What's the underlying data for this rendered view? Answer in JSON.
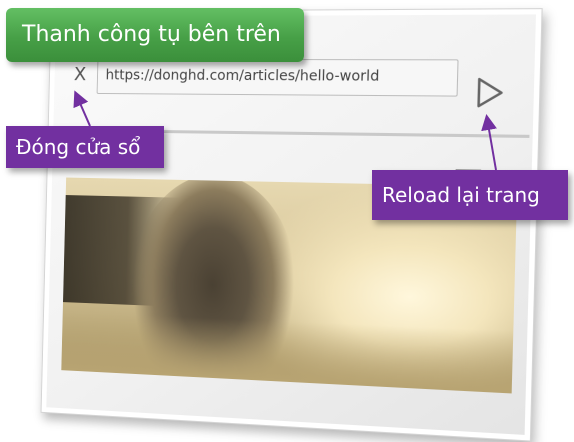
{
  "browser": {
    "url": "https://donghd.com/articles/hello-world",
    "close_glyph": "X",
    "icons": [
      "close-icon",
      "play-reload-icon",
      "menu-icon"
    ]
  },
  "callouts": {
    "top_bar": "Thanh công tụ bên trên",
    "close_window": "Đóng cửa sổ",
    "reload": "Reload lại trang"
  },
  "colors": {
    "top_bar_callout": "#4aa64a",
    "label_callout": "#7230a0",
    "arrow": "#7230a0"
  }
}
